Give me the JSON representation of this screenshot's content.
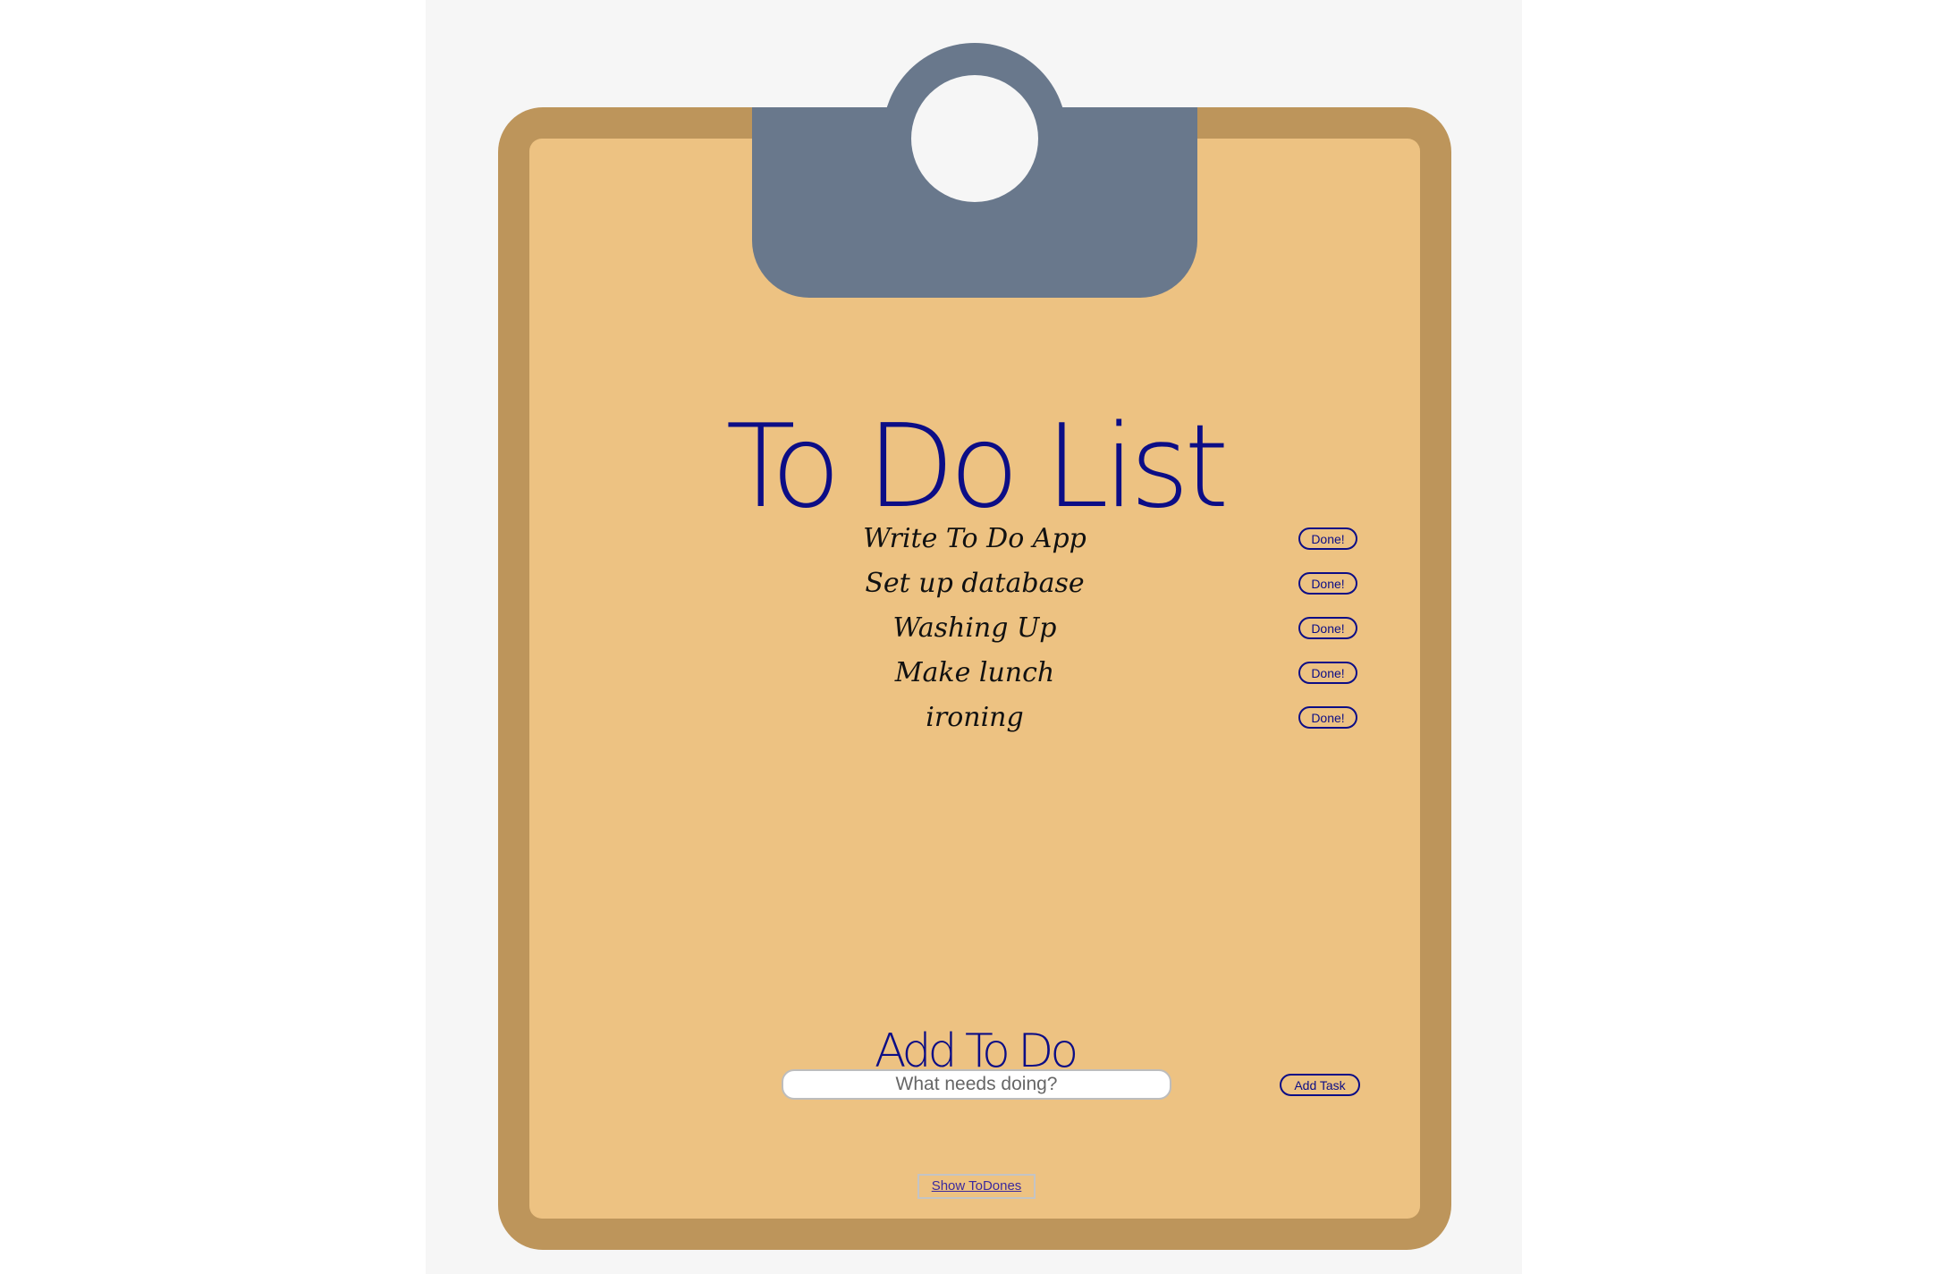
{
  "app": {
    "title": "To Do List"
  },
  "todos": {
    "items": [
      {
        "text": "Write To Do App",
        "done_label": "Done!"
      },
      {
        "text": "Set up database",
        "done_label": "Done!"
      },
      {
        "text": "Washing Up",
        "done_label": "Done!"
      },
      {
        "text": "Make lunch",
        "done_label": "Done!"
      },
      {
        "text": "ironing",
        "done_label": "Done!"
      }
    ]
  },
  "add_form": {
    "heading": "Add To Do",
    "input_value": "",
    "input_placeholder": "What needs doing?",
    "submit_label": "Add Task"
  },
  "footer": {
    "show_todones_label": "Show ToDones"
  },
  "colors": {
    "page_background": "#f6f6f6",
    "clipboard_board": "#bd955b",
    "paper": "#edc282",
    "clip": "#69788c",
    "accent_text": "#0c0d86"
  },
  "icons": {
    "clip": "clipboard-clip-icon"
  }
}
